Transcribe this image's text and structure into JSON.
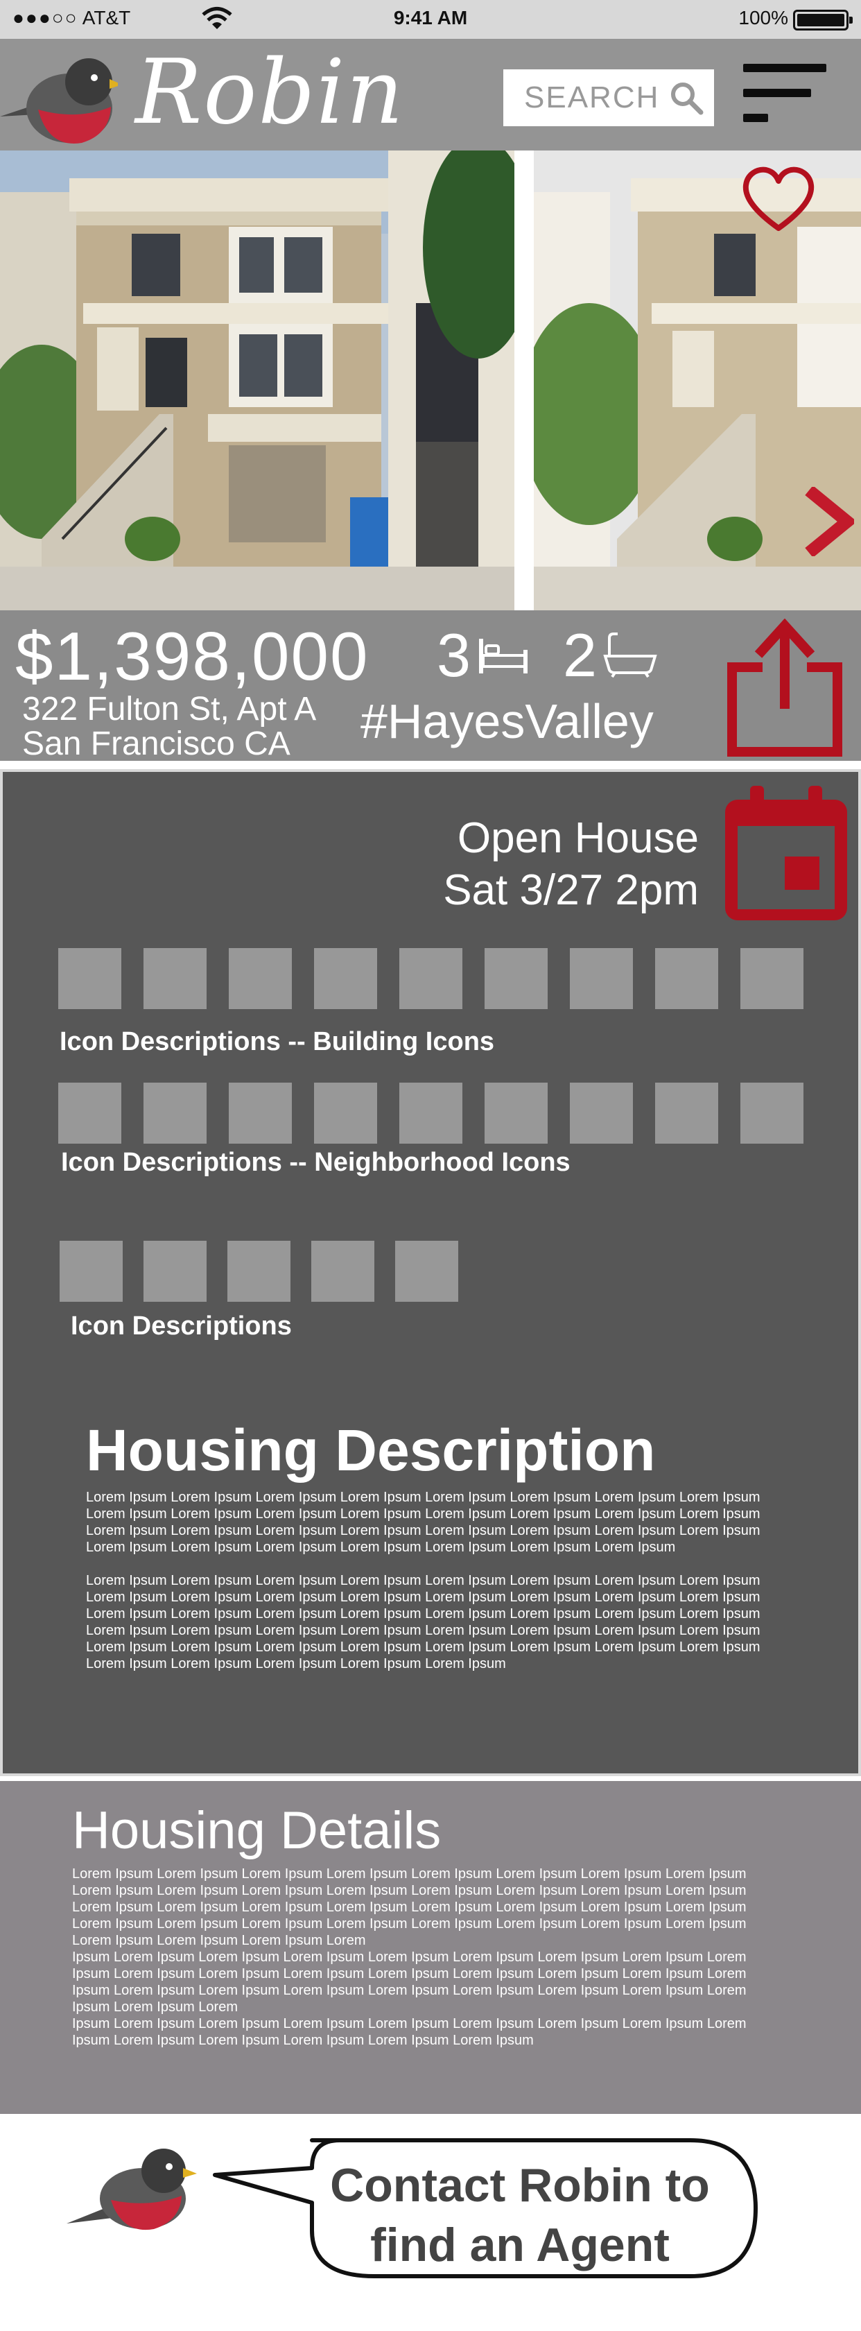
{
  "status_bar": {
    "carrier": "AT&T",
    "time": "9:41 AM",
    "battery": "100%"
  },
  "header": {
    "logo_text": "Robin",
    "search_label": "SEARCH"
  },
  "listing": {
    "price": "$1,398,000",
    "address_line1": "322 Fulton St, Apt A",
    "address_line2": "San Francisco CA",
    "beds": "3",
    "baths": "2",
    "hashtag": "#HayesValley"
  },
  "open_house": {
    "line1": "Open House",
    "line2": "Sat 3/27 2pm"
  },
  "icon_sections": {
    "building_label": "Icon Descriptions -- Building Icons",
    "neighborhood_label": "Icon Descriptions -- Neighborhood Icons",
    "other_label": "Icon Descriptions"
  },
  "description": {
    "title": "Housing Description",
    "para1": "Lorem Ipsum Lorem Ipsum Lorem Ipsum Lorem Ipsum Lorem Ipsum Lorem Ipsum Lorem Ipsum Lorem Ipsum Lorem Ipsum Lorem Ipsum Lorem Ipsum Lorem Ipsum Lorem Ipsum Lorem Ipsum Lorem Ipsum Lorem Ipsum Lorem Ipsum Lorem Ipsum Lorem Ipsum Lorem Ipsum Lorem Ipsum Lorem Ipsum Lorem Ipsum Lorem Ipsum Lorem Ipsum Lorem Ipsum Lorem Ipsum Lorem Ipsum Lorem Ipsum Lorem Ipsum Lorem Ipsum",
    "para2": "Lorem Ipsum Lorem Ipsum Lorem Ipsum Lorem Ipsum Lorem Ipsum Lorem Ipsum Lorem Ipsum Lorem Ipsum Lorem Ipsum Lorem Ipsum Lorem Ipsum Lorem Ipsum Lorem Ipsum Lorem Ipsum Lorem Ipsum Lorem Ipsum Lorem Ipsum Lorem Ipsum Lorem Ipsum Lorem Ipsum Lorem Ipsum Lorem Ipsum Lorem Ipsum Lorem Ipsum Lorem Ipsum Lorem Ipsum Lorem Ipsum Lorem Ipsum Lorem Ipsum Lorem Ipsum Lorem Ipsum Lorem Ipsum Lorem Ipsum Lorem Ipsum Lorem Ipsum Lorem Ipsum Lorem Ipsum Lorem Ipsum Lorem Ipsum Lorem Ipsum Lorem Ipsum Lorem Ipsum Lorem Ipsum Lorem Ipsum Lorem Ipsum"
  },
  "details": {
    "title": "Housing Details",
    "para1": "Lorem Ipsum Lorem Ipsum Lorem Ipsum Lorem Ipsum Lorem Ipsum Lorem Ipsum Lorem Ipsum Lorem Ipsum Lorem Ipsum Lorem Ipsum Lorem Ipsum Lorem Ipsum Lorem Ipsum Lorem Ipsum Lorem Ipsum Lorem Ipsum Lorem Ipsum Lorem Ipsum Lorem Ipsum Lorem Ipsum Lorem Ipsum Lorem Ipsum Lorem Ipsum Lorem Ipsum Lorem Ipsum Lorem Ipsum Lorem Ipsum Lorem Ipsum Lorem Ipsum Lorem Ipsum Lorem Ipsum Lorem Ipsum Lorem Ipsum Lorem Ipsum Lorem Ipsum Lorem",
    "para2": "Ipsum Lorem Ipsum Lorem Ipsum Lorem Ipsum Lorem Ipsum Lorem Ipsum Lorem Ipsum Lorem Ipsum Lorem Ipsum Lorem Ipsum Lorem Ipsum Lorem Ipsum Lorem Ipsum Lorem Ipsum Lorem Ipsum Lorem Ipsum Lorem Ipsum Lorem Ipsum Lorem Ipsum Lorem Ipsum Lorem Ipsum Lorem Ipsum Lorem Ipsum Lorem Ipsum Lorem Ipsum Lorem Ipsum Lorem",
    "para3": "Ipsum Lorem Ipsum Lorem Ipsum Lorem Ipsum Lorem Ipsum Lorem Ipsum Lorem Ipsum Lorem Ipsum Lorem Ipsum Lorem Ipsum Lorem Ipsum Lorem Ipsum Lorem Ipsum Lorem Ipsum"
  },
  "footer": {
    "cta": "Contact Robin to find an Agent"
  },
  "icons": {
    "favorite": "heart-icon",
    "next": "chevron-right-icon",
    "share": "share-icon",
    "calendar": "calendar-icon",
    "bed": "bed-icon",
    "bath": "bathtub-icon",
    "search": "search-icon",
    "menu": "hamburger-menu-icon"
  },
  "colors": {
    "accent_red": "#b3101e",
    "header_gray": "#949494",
    "panel_dark": "#575757",
    "details_gray": "#8b878b"
  }
}
